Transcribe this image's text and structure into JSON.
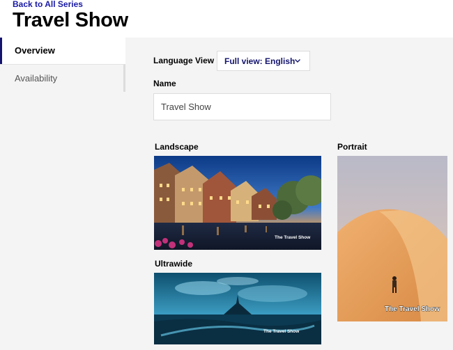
{
  "header": {
    "back_link": "Back to All Series",
    "title": "Travel Show"
  },
  "sidebar": {
    "items": [
      {
        "label": "Overview",
        "active": true
      },
      {
        "label": "Availability",
        "active": false
      }
    ]
  },
  "form": {
    "language_label": "Language View",
    "language_value": "Full view: English",
    "name_label": "Name",
    "name_value": "Travel Show"
  },
  "images": {
    "landscape": {
      "label": "Landscape",
      "watermark": "The Travel Show"
    },
    "portrait": {
      "label": "Portrait",
      "watermark": "The Travel Show"
    },
    "ultrawide": {
      "label": "Ultrawide",
      "watermark": "The Travel Show"
    }
  },
  "colors": {
    "accent": "#14146e",
    "link": "#1a1aa6",
    "background": "#f4f4f4"
  }
}
